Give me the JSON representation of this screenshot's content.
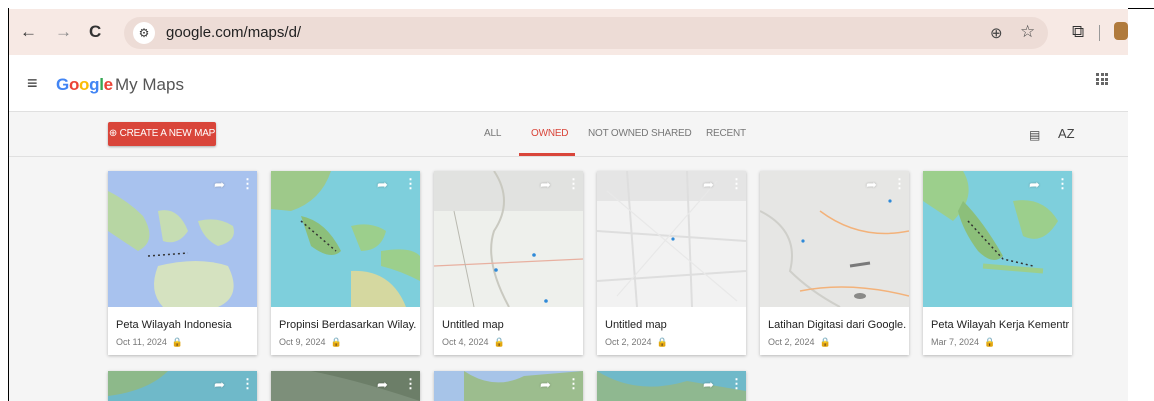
{
  "browser": {
    "url": "google.com/maps/d/",
    "back_icon": "←",
    "forward_icon": "→",
    "reload_icon": "C",
    "site_info_icon": "⚙",
    "zoom_icon": "⊕",
    "star_icon": "☆",
    "extensions_icon": "⧉"
  },
  "app": {
    "logo_letters": [
      "G",
      "o",
      "o",
      "g",
      "l",
      "e"
    ],
    "logo_colors": [
      "#4285f4",
      "#ea4335",
      "#fbbc05",
      "#4285f4",
      "#34a853",
      "#ea4335"
    ],
    "product_name": "My Maps",
    "menu_icon": "≡"
  },
  "toolbar": {
    "create_label": "CREATE A NEW MAP",
    "create_icon": "⊕",
    "tabs": [
      "ALL",
      "OWNED",
      "NOT OWNED",
      "SHARED",
      "RECENT"
    ],
    "active_tab": "OWNED",
    "accent_color": "#d9453a",
    "list_view_icon": "▤",
    "sort_icon": "AZ"
  },
  "maps": [
    {
      "title": "Peta Wilayah Indonesia",
      "date": "Oct 11, 2024"
    },
    {
      "title": "Propinsi Berdasarkan Wilay...",
      "date": "Oct 9, 2024"
    },
    {
      "title": "Untitled map",
      "date": "Oct 4, 2024"
    },
    {
      "title": "Untitled map",
      "date": "Oct 2, 2024"
    },
    {
      "title": "Latihan Digitasi dari Google...",
      "date": "Oct 2, 2024"
    },
    {
      "title": "Peta Wilayah Kerja Kementr...",
      "date": "Mar 7, 2024"
    }
  ],
  "card_icons": {
    "share": "➦",
    "more": "⋮",
    "lock": "🔒"
  }
}
